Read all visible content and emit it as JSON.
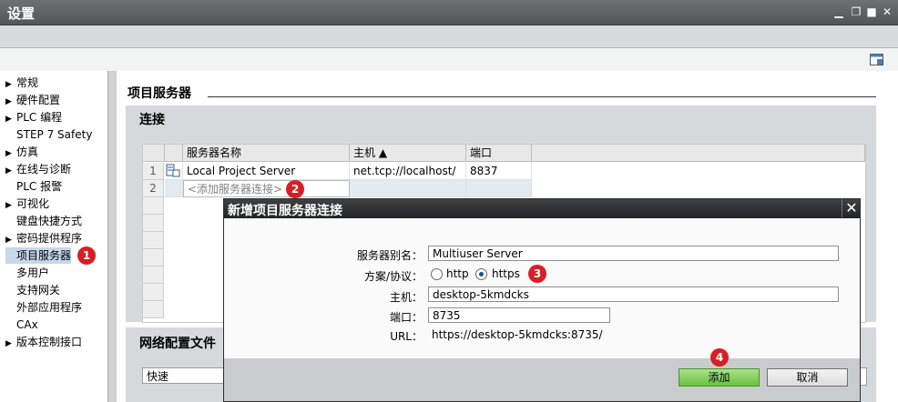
{
  "window": {
    "title": "设置"
  },
  "nav": {
    "items": [
      {
        "label": "常规",
        "arrow": "▶"
      },
      {
        "label": "硬件配置",
        "arrow": "▶"
      },
      {
        "label": "PLC 编程",
        "arrow": "▶"
      },
      {
        "label": "STEP 7 Safety",
        "arrow": ""
      },
      {
        "label": "仿真",
        "arrow": "▶"
      },
      {
        "label": "在线与诊断",
        "arrow": "▶"
      },
      {
        "label": "PLC 报警",
        "arrow": ""
      },
      {
        "label": "可视化",
        "arrow": "▶"
      },
      {
        "label": "键盘快捷方式",
        "arrow": ""
      },
      {
        "label": "密码提供程序",
        "arrow": "▶"
      },
      {
        "label": "项目服务器",
        "arrow": ""
      },
      {
        "label": "多用户",
        "arrow": ""
      },
      {
        "label": "支持网关",
        "arrow": ""
      },
      {
        "label": "外部应用程序",
        "arrow": ""
      },
      {
        "label": "CAx",
        "arrow": ""
      },
      {
        "label": "版本控制接口",
        "arrow": "▶"
      }
    ]
  },
  "main": {
    "section_title": "项目服务器",
    "connection": {
      "title": "连接",
      "columns": [
        "服务器名称",
        "主机 ▲",
        "端口"
      ],
      "rows": [
        {
          "num": "1",
          "name": "Local Project Server",
          "host": "net.tcp://localhost/",
          "port": "8837"
        },
        {
          "num": "2",
          "name": "<添加服务器连接>",
          "host": "",
          "port": ""
        }
      ]
    },
    "network": {
      "title": "网络配置文件",
      "selected": "快速"
    }
  },
  "dialog": {
    "title": "新增项目服务器连接",
    "alias_label": "服务器别名：",
    "alias_value": "Multiuser Server",
    "scheme_label": "方案/协议：",
    "scheme_options": [
      "http",
      "https"
    ],
    "scheme_selected": "https",
    "host_label": "主机：",
    "host_value": "desktop-5kmdcks",
    "port_label": "端口：",
    "port_value": "8735",
    "url_label": "URL：",
    "url_value": "https://desktop-5kmdcks:8735/",
    "add_button": "添加",
    "cancel_button": "取消"
  },
  "badges": [
    "1",
    "2",
    "3",
    "4"
  ],
  "colors": {
    "badge": "#d71f26",
    "selection": "#c6d8ea",
    "add_button": "#7fcf5a"
  }
}
